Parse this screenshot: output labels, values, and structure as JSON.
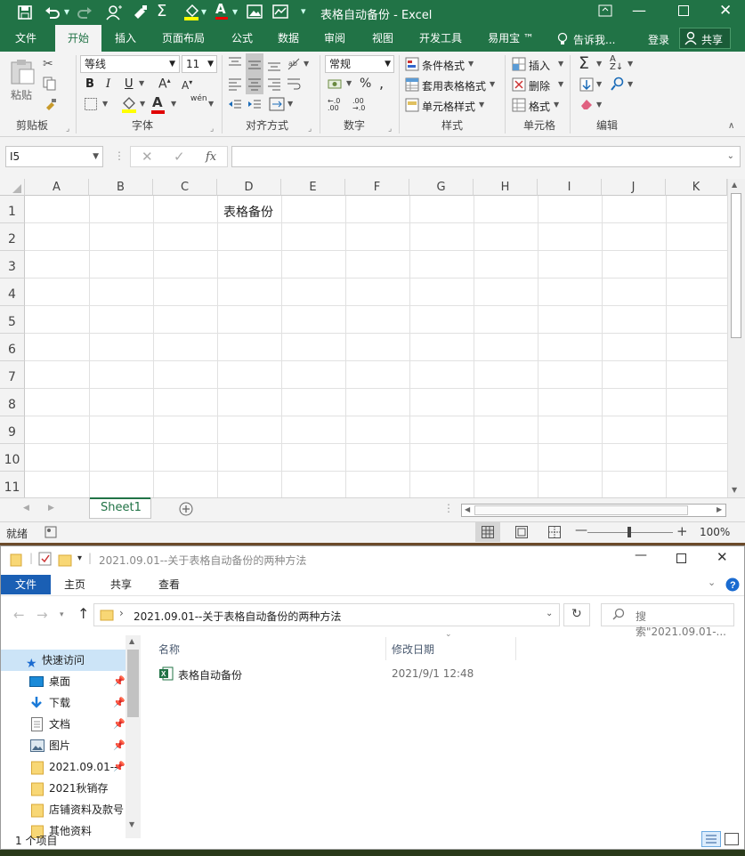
{
  "excel": {
    "title": "表格自动备份 - Excel",
    "tabs": [
      "文件",
      "开始",
      "插入",
      "页面布局",
      "公式",
      "数据",
      "审阅",
      "视图",
      "开发工具",
      "易用宝 ™"
    ],
    "tell_me": "告诉我...",
    "login": "登录",
    "share": "共享",
    "ribbon": {
      "paste": "粘贴",
      "clipboard": "剪贴板",
      "font_name": "等线",
      "font_size": "11",
      "font_group": "字体",
      "align_group": "对齐方式",
      "number_format": "常规",
      "number_group": "数字",
      "cond_format": "条件格式",
      "table_format": "套用表格格式",
      "cell_style": "单元格样式",
      "style_group": "样式",
      "insert": "插入",
      "delete": "删除",
      "format": "格式",
      "cells_group": "单元格",
      "edit_group": "编辑",
      "bold": "B",
      "italic": "I",
      "underline": "U",
      "font_color_glyph": "A",
      "percent": "%",
      "wen": "wén"
    },
    "name_box": "I5",
    "formula_value": "",
    "columns": [
      "A",
      "B",
      "C",
      "D",
      "E",
      "F",
      "G",
      "H",
      "I",
      "J",
      "K"
    ],
    "rows": [
      "1",
      "2",
      "3",
      "4",
      "5",
      "6",
      "7",
      "8",
      "9",
      "10",
      "11"
    ],
    "cell_D1": "表格备份",
    "sheet_tab": "Sheet1",
    "status_text": "就绪",
    "zoom": "100%"
  },
  "explorer": {
    "title": "2021.09.01--关于表格自动备份的两种方法",
    "tabs": [
      "文件",
      "主页",
      "共享",
      "查看"
    ],
    "path_current": "2021.09.01--关于表格自动备份的两种方法",
    "search_placeholder": "搜索\"2021.09.01-...",
    "col_name": "名称",
    "col_date": "修改日期",
    "nav": {
      "quick_access": "快速访问",
      "items": [
        "桌面",
        "下载",
        "文档",
        "图片",
        "2021.09.01--",
        "2021秋销存",
        "店铺资料及款号",
        "其他资料"
      ]
    },
    "files": [
      {
        "name": "表格自动备份",
        "date": "2021/9/1 12:48"
      }
    ],
    "status": "1 个项目"
  },
  "colors": {
    "excel_green": "#217346",
    "explorer_blue": "#1a5fb4"
  }
}
